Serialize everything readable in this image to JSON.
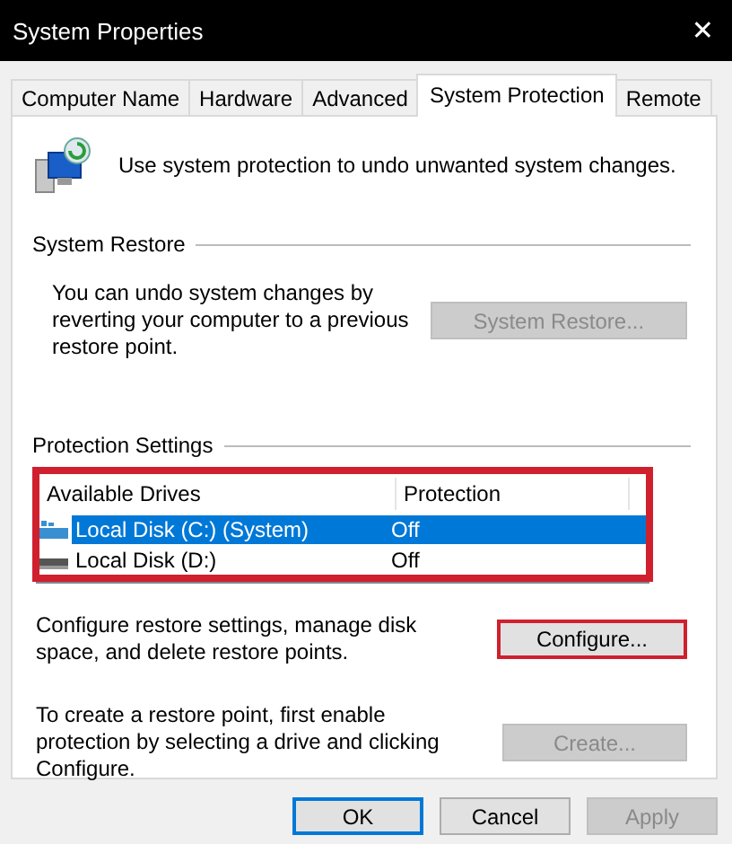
{
  "window": {
    "title": "System Properties",
    "close": "✕"
  },
  "tabs": [
    {
      "label": "Computer Name",
      "selected": false
    },
    {
      "label": "Hardware",
      "selected": false
    },
    {
      "label": "Advanced",
      "selected": false
    },
    {
      "label": "System Protection",
      "selected": true
    },
    {
      "label": "Remote",
      "selected": false
    }
  ],
  "intro": "Use system protection to undo unwanted system changes.",
  "system_restore": {
    "heading": "System Restore",
    "text": "You can undo system changes by reverting your computer to a previous restore point.",
    "button": {
      "label": "System Restore...",
      "disabled": true,
      "highlighted": false
    }
  },
  "protection_settings": {
    "heading": "Protection Settings",
    "highlighted": true,
    "columns": [
      "Available Drives",
      "Protection"
    ],
    "drives": [
      {
        "name": "Local Disk (C:) (System)",
        "protection": "Off",
        "kind": "system",
        "selected": true
      },
      {
        "name": "Local Disk (D:)",
        "protection": "Off",
        "kind": "disk",
        "selected": false
      }
    ],
    "configure": {
      "text": "Configure restore settings, manage disk space, and delete restore points.",
      "button": {
        "label": "Configure...",
        "disabled": false,
        "highlighted": true
      }
    },
    "create": {
      "text": "To create a restore point, first enable protection by selecting a drive and clicking Configure.",
      "button": {
        "label": "Create...",
        "disabled": true,
        "highlighted": false
      }
    }
  },
  "buttons": [
    {
      "label": "OK",
      "disabled": false,
      "default": true
    },
    {
      "label": "Cancel",
      "disabled": false,
      "default": false
    },
    {
      "label": "Apply",
      "disabled": true,
      "default": false
    }
  ]
}
